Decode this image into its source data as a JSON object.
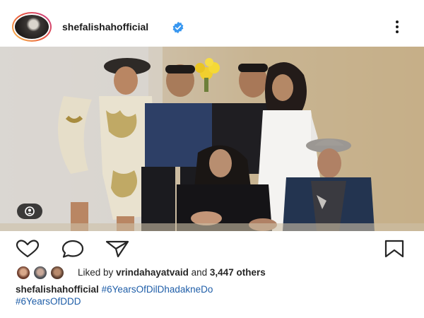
{
  "post": {
    "username": "shefalishahofficial",
    "verified": true,
    "more_icon": "more-vertical-icon",
    "photo_description_icon": "user-tag-icon"
  },
  "actions": {
    "like_icon": "heart-icon",
    "comment_icon": "comment-icon",
    "share_icon": "send-icon",
    "save_icon": "bookmark-icon"
  },
  "likes": {
    "prefix": "Liked by",
    "liker": "vrindahayatvaid",
    "conjunction": "and",
    "others": "3,447 others"
  },
  "caption": {
    "username": "shefalishahofficial",
    "hashtags": [
      "#6YearsOfDilDhadakneDo",
      "#6YearsOfDDD"
    ]
  },
  "colors": {
    "verified_badge": "#3897f0",
    "hashtag": "#1f5ea8",
    "text": "#262626"
  }
}
